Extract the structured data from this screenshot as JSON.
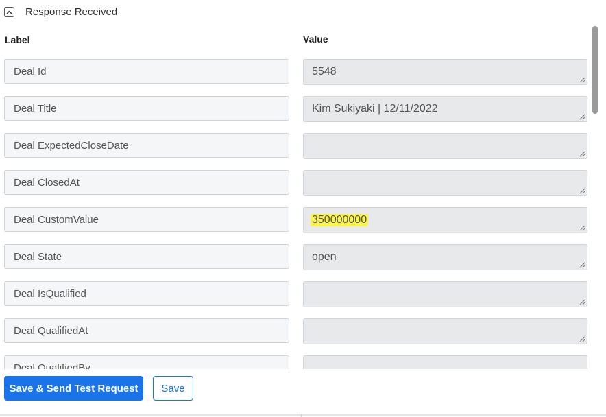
{
  "section": {
    "title": "Response Received"
  },
  "columns": {
    "label": "Label",
    "value": "Value"
  },
  "fields": [
    {
      "label": "Deal Id",
      "value": "5548"
    },
    {
      "label": "Deal Title",
      "value": "Kim Sukiyaki | 12/11/2022"
    },
    {
      "label": "Deal ExpectedCloseDate",
      "value": ""
    },
    {
      "label": "Deal ClosedAt",
      "value": ""
    },
    {
      "label": "Deal CustomValue",
      "value": "350000000",
      "highlighted": true
    },
    {
      "label": "Deal State",
      "value": "open"
    },
    {
      "label": "Deal IsQualified",
      "value": ""
    },
    {
      "label": "Deal QualifiedAt",
      "value": ""
    },
    {
      "label": "Deal QualifiedBy",
      "value": ""
    }
  ],
  "actions": {
    "primary_label": "Save & Send Test Request",
    "secondary_label": "Save"
  },
  "colors": {
    "accent": "#1a73e8",
    "highlight": "#fbf44a"
  }
}
